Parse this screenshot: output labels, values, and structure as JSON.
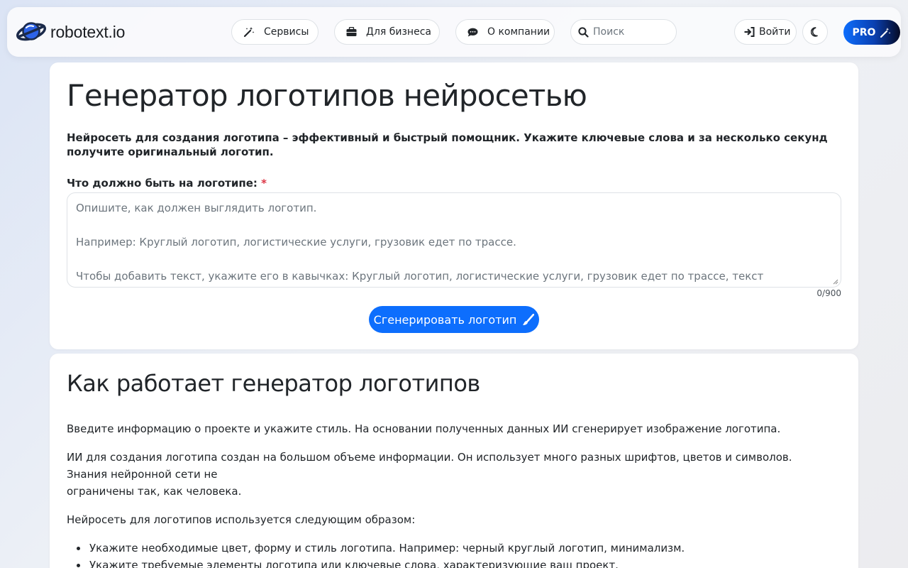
{
  "brand": {
    "name": "robotext.io"
  },
  "nav": {
    "services": "Сервисы",
    "business": "Для бизнеса",
    "about": "О компании",
    "search_placeholder": "Поиск",
    "login": "Войти",
    "pro": "PRO"
  },
  "hero": {
    "title": "Генератор логотипов нейросетью",
    "lead": "Нейросеть для создания логотипа – эффективный и быстрый помощник. Укажите ключевые слова и за несколько секунд получите оригинальный логотип.",
    "field_label": "Что должно быть на логотипе:",
    "required_mark": "*",
    "placeholder_line1": "Опишите, как должен выглядить логотип.",
    "placeholder_line2": "Например: Круглый логотип, логистические услуги, грузовик едет по трассе.",
    "placeholder_line3": "Чтобы добавить текст, укажите его в кавычках: Круглый логотип, логистические услуги, грузовик едет по трассе, текст \"ЛогистикА\".",
    "counter": "0/900",
    "generate_button": "Сгенерировать логотип"
  },
  "how": {
    "title": "Как работает генератор логотипов",
    "p1": "Введите информацию о проекте и укажите стиль. На основании полученных данных ИИ сгенерирует изображение логотипа.",
    "p2a": "ИИ для создания логотипа создан на большом объеме информации. Он использует много разных шрифтов, цветов и символов. Знания нейронной сети не",
    "p2b": "ограничены так, как человека.",
    "p3": "Нейросеть для логотипов используется следующим образом:",
    "bullets": [
      "Укажите необходимые цвет, форму и стиль логотипа. Например: черный круглый логотип, минимализм.",
      "Укажите требуемые элементы логотипа или ключевые слова, характеризующие ваш проект."
    ]
  },
  "colors": {
    "primary": "#0d6efd",
    "required": "#dc3545",
    "text": "#212529"
  }
}
